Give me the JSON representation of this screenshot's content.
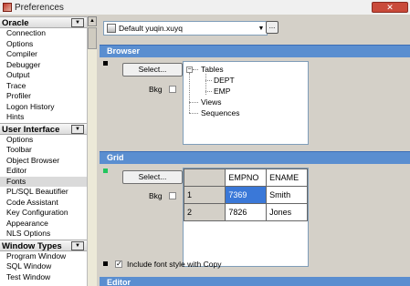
{
  "window": {
    "title": "Preferences"
  },
  "sidebar": {
    "categories": [
      {
        "label": "Oracle",
        "items": [
          "Connection",
          "Options",
          "Compiler",
          "Debugger",
          "Output",
          "Trace",
          "Profiler",
          "Logon History",
          "Hints"
        ]
      },
      {
        "label": "User Interface",
        "items": [
          "Options",
          "Toolbar",
          "Object Browser",
          "Editor",
          "Fonts",
          "PL/SQL Beautifier",
          "Code Assistant",
          "Key Configuration",
          "Appearance",
          "NLS Options"
        ]
      },
      {
        "label": "Window Types",
        "items": [
          "Program Window",
          "SQL Window",
          "Test Window"
        ]
      }
    ],
    "selected": "Fonts"
  },
  "profile": {
    "value": "Default yuqin.xuyq",
    "more_button": "..."
  },
  "browser": {
    "header": "Browser",
    "select_label": "Select...",
    "bkg_label": "Bkg",
    "tree": {
      "root": "Tables",
      "children": [
        "DEPT",
        "EMP"
      ],
      "siblings": [
        "Views",
        "Sequences"
      ]
    }
  },
  "grid": {
    "header": "Grid",
    "select_label": "Select...",
    "bkg_label": "Bkg",
    "columns": [
      "EMPNO",
      "ENAME"
    ],
    "rows": [
      {
        "num": "1",
        "empno": "7369",
        "ename": "Smith"
      },
      {
        "num": "2",
        "empno": "7826",
        "ename": "Jones"
      }
    ],
    "include_font_style": "Include font style with Copy"
  },
  "editor": {
    "header": "Editor"
  },
  "colors": {
    "section_header": "#5a8ed0",
    "selection": "#3a78d8",
    "grid_marker": "#22c55e"
  }
}
